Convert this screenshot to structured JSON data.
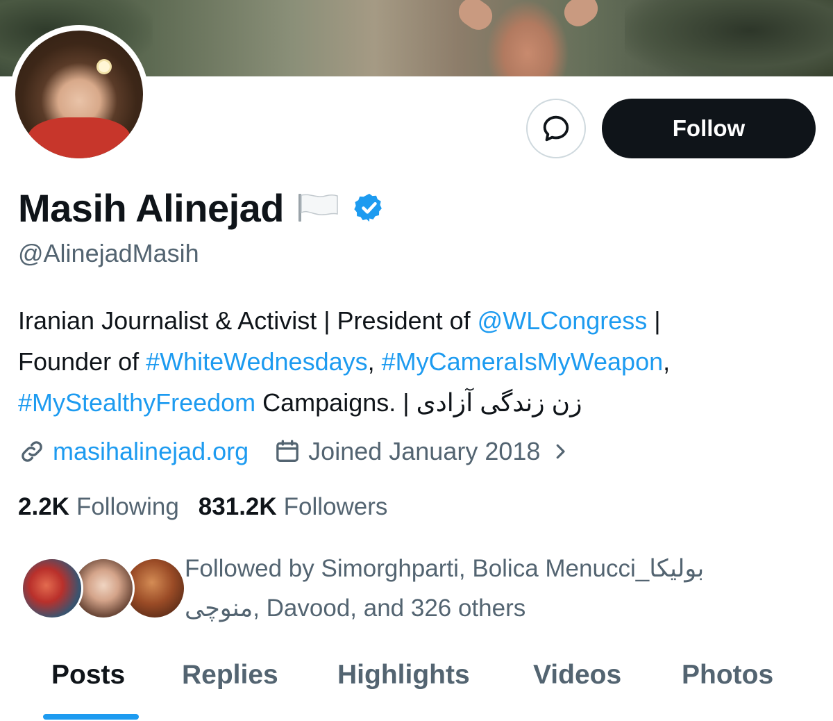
{
  "profile": {
    "name": "Masih Alinejad",
    "flag_icon": "white-flag-icon",
    "verified_icon": "verified-badge-icon",
    "verified_color": "#1d9bf0",
    "handle": "@AlinejadMasih"
  },
  "actions": {
    "message_icon": "message-bubble-icon",
    "follow_label": "Follow"
  },
  "bio": {
    "l1_a": "Iranian Journalist & Activist | President of ",
    "l1_link": "@WLCongress",
    "l1_b": " |",
    "l2_a": "Founder of ",
    "l2_link1": "#WhiteWednesdays",
    "l2_sep": ", ",
    "l2_link2": "#MyCameraIsMyWeapon",
    "l2_b": ",",
    "l3_link": "#MyStealthyFreedom",
    "l3_b": " Campaigns. | زن زندگی آزادی"
  },
  "meta": {
    "website": "masihalinejad.org",
    "joined": "Joined January 2018",
    "link_icon": "link-icon",
    "calendar_icon": "calendar-icon",
    "chevron_icon": "chevron-right-icon"
  },
  "stats": {
    "following_count": "2.2K",
    "following_label": "Following",
    "followers_count": "831.2K",
    "followers_label": "Followers"
  },
  "followed_by": {
    "line1": "Followed by Simorghparti, Bolica Menucci_بولیکا",
    "line2": "منوچی, Davood, and 326 others"
  },
  "tabs": [
    {
      "label": "Posts",
      "active": true
    },
    {
      "label": "Replies",
      "active": false
    },
    {
      "label": "Highlights",
      "active": false
    },
    {
      "label": "Videos",
      "active": false
    },
    {
      "label": "Photos",
      "active": false
    }
  ],
  "colors": {
    "accent": "#1d9bf0",
    "text_primary": "#0f1419",
    "text_secondary": "#536471",
    "follow_bg": "#0f1419"
  }
}
